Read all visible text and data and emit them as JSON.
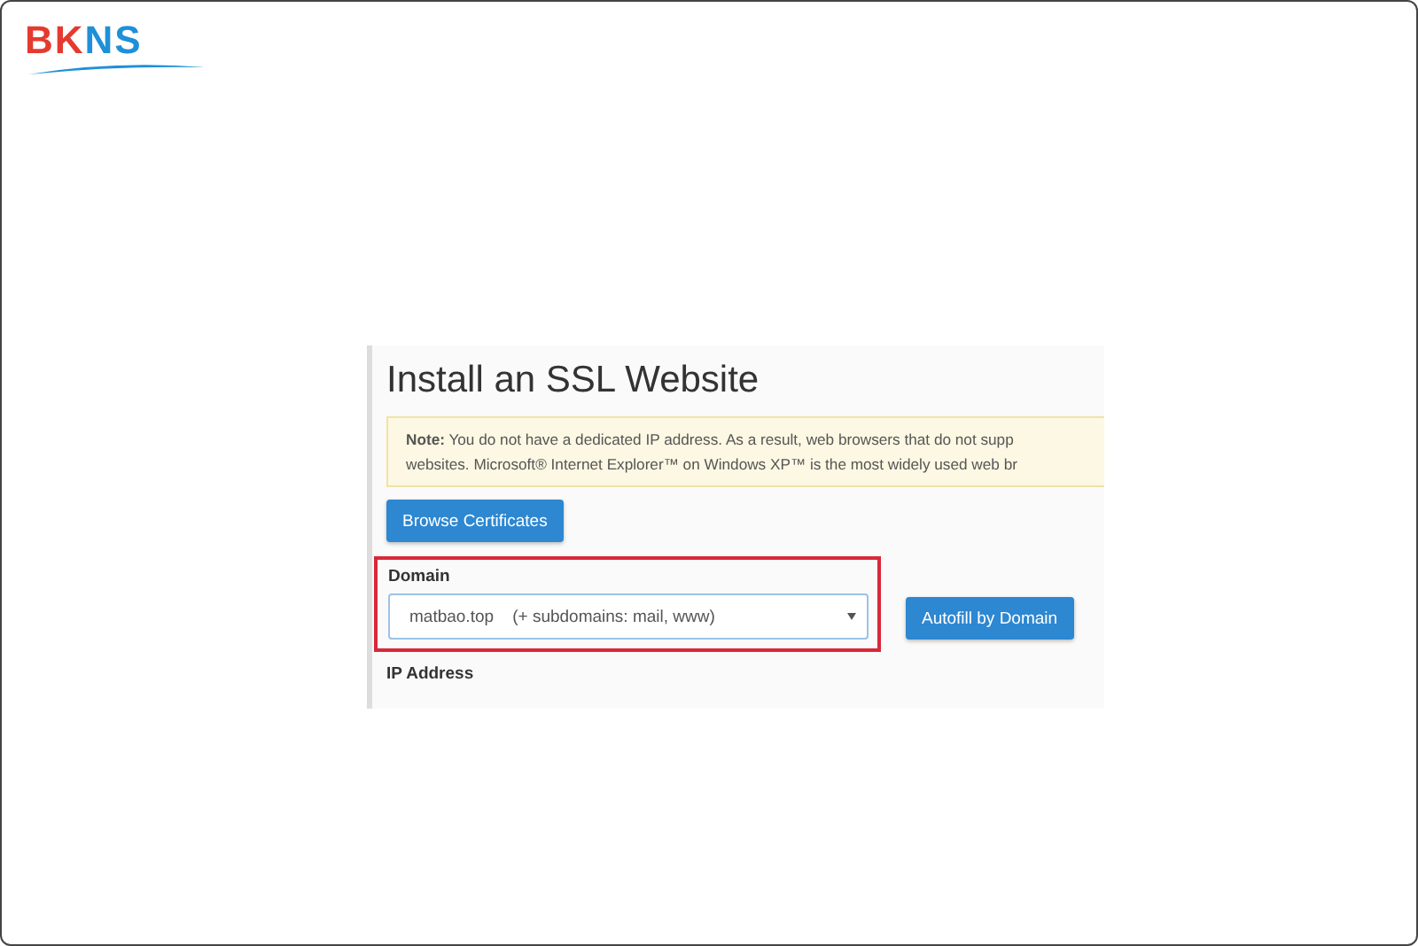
{
  "logo": {
    "parts": [
      {
        "text": "BK",
        "color": "#e53a2f"
      },
      {
        "text": "NS",
        "color": "#1e90d8"
      }
    ]
  },
  "screenshot": {
    "title": "Install an SSL Website",
    "note": [
      "**Note:** You do not have a dedicated IP address. As a result, web browsers that do not supp",
      "websites. Microsoft® Internet Explorer™ on Windows XP™ is the most widely used web br"
    ],
    "browse_button": "Browse Certificates",
    "domain": {
      "label": "Domain",
      "value": "matbao.top    (+ subdomains: mail, www)",
      "highlighted": true
    },
    "autofill_button": "Autofill by Domain",
    "ip_label": "IP Address"
  }
}
